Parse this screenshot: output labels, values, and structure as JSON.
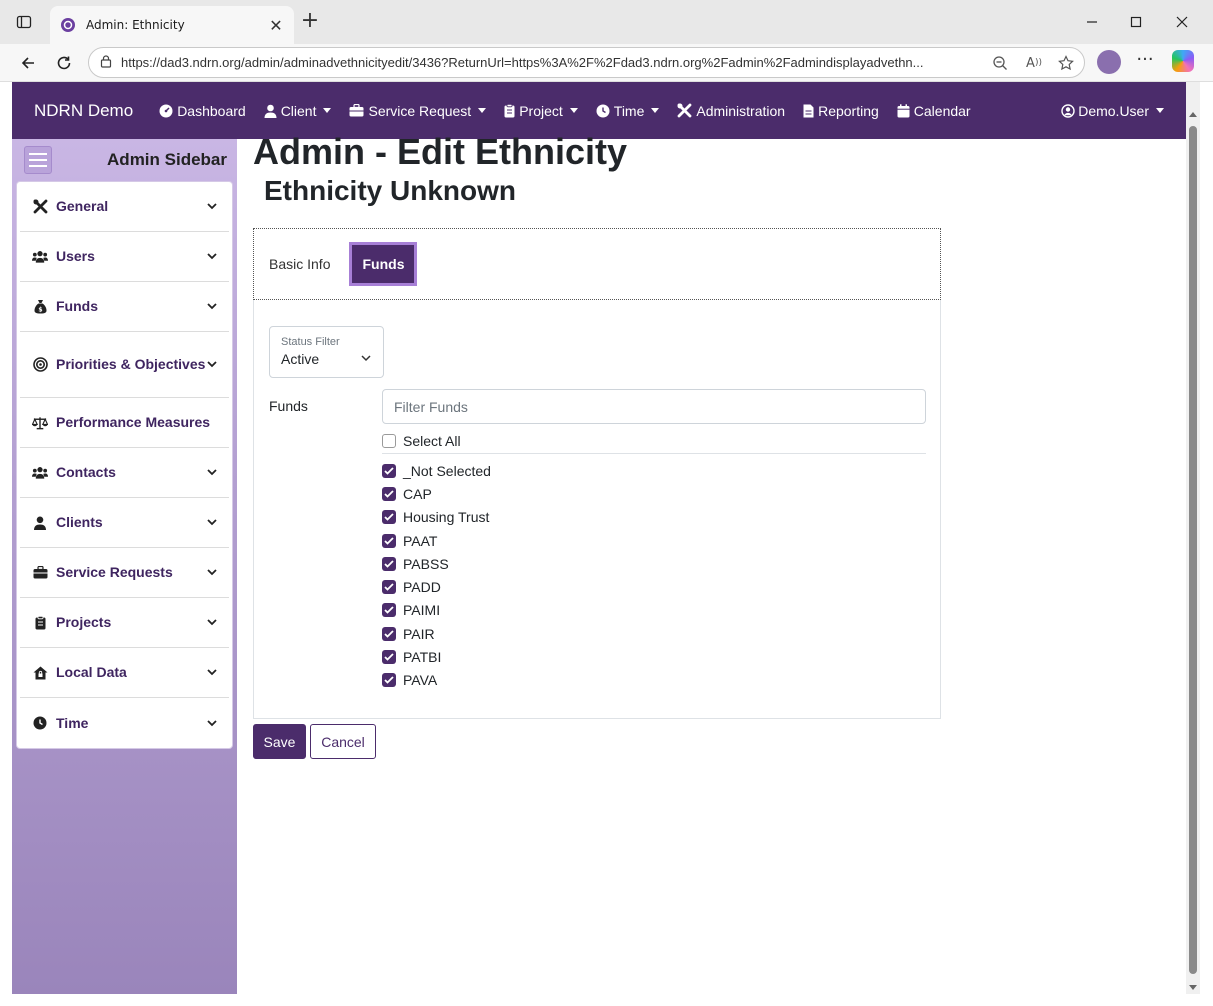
{
  "browser": {
    "tab_title": "Admin: Ethnicity",
    "url": "https://dad3.ndrn.org/admin/adminadvethnicityedit/3436?ReturnUrl=https%3A%2F%2Fdad3.ndrn.org%2Fadmin%2Fadmindisplayadvethn..."
  },
  "navbar": {
    "brand": "NDRN Demo",
    "items": [
      {
        "label": "Dashboard",
        "icon": "dashboard-icon",
        "dropdown": false
      },
      {
        "label": "Client",
        "icon": "user-icon",
        "dropdown": true
      },
      {
        "label": "Service Request",
        "icon": "briefcase-icon",
        "dropdown": true
      },
      {
        "label": "Project",
        "icon": "clipboard-icon",
        "dropdown": true
      },
      {
        "label": "Time",
        "icon": "clock-icon",
        "dropdown": true
      },
      {
        "label": "Administration",
        "icon": "tools-icon",
        "dropdown": false
      },
      {
        "label": "Reporting",
        "icon": "file-icon",
        "dropdown": false
      },
      {
        "label": "Calendar",
        "icon": "calendar-icon",
        "dropdown": false
      }
    ],
    "user": "Demo.User"
  },
  "sidebar": {
    "title": "Admin Sidebar",
    "items": [
      {
        "label": "General",
        "icon": "tools-icon",
        "expandable": true
      },
      {
        "label": "Users",
        "icon": "users-icon",
        "expandable": true
      },
      {
        "label": "Funds",
        "icon": "money-bag-icon",
        "expandable": true
      },
      {
        "label": "Priorities & Objectives",
        "icon": "target-icon",
        "expandable": true
      },
      {
        "label": "Performance Measures",
        "icon": "scale-icon",
        "expandable": false
      },
      {
        "label": "Contacts",
        "icon": "users-icon",
        "expandable": true
      },
      {
        "label": "Clients",
        "icon": "user-icon",
        "expandable": true
      },
      {
        "label": "Service Requests",
        "icon": "briefcase-icon",
        "expandable": true
      },
      {
        "label": "Projects",
        "icon": "clipboard-icon",
        "expandable": true
      },
      {
        "label": "Local Data",
        "icon": "house-lock-icon",
        "expandable": true
      },
      {
        "label": "Time",
        "icon": "clock-icon",
        "expandable": true
      }
    ]
  },
  "page": {
    "title": "Admin - Edit Ethnicity",
    "subtitle": "Ethnicity Unknown",
    "tabs": [
      {
        "label": "Basic Info",
        "active": false
      },
      {
        "label": "Funds",
        "active": true
      }
    ],
    "status_filter": {
      "label": "Status Filter",
      "value": "Active"
    },
    "funds_label": "Funds",
    "filter_placeholder": "Filter Funds",
    "select_all": {
      "label": "Select All",
      "checked": false
    },
    "funds": [
      {
        "label": "_Not Selected",
        "checked": true
      },
      {
        "label": "CAP",
        "checked": true
      },
      {
        "label": "Housing Trust",
        "checked": true
      },
      {
        "label": "PAAT",
        "checked": true
      },
      {
        "label": "PABSS",
        "checked": true
      },
      {
        "label": "PADD",
        "checked": true
      },
      {
        "label": "PAIMI",
        "checked": true
      },
      {
        "label": "PAIR",
        "checked": true
      },
      {
        "label": "PATBI",
        "checked": true
      },
      {
        "label": "PAVA",
        "checked": true
      }
    ],
    "save_label": "Save",
    "cancel_label": "Cancel"
  },
  "colors": {
    "brand_purple": "#4b2c6b",
    "tab_border": "#a77fd6",
    "sidebar_top": "#c9b6e4",
    "sidebar_bottom": "#9a85bb"
  }
}
